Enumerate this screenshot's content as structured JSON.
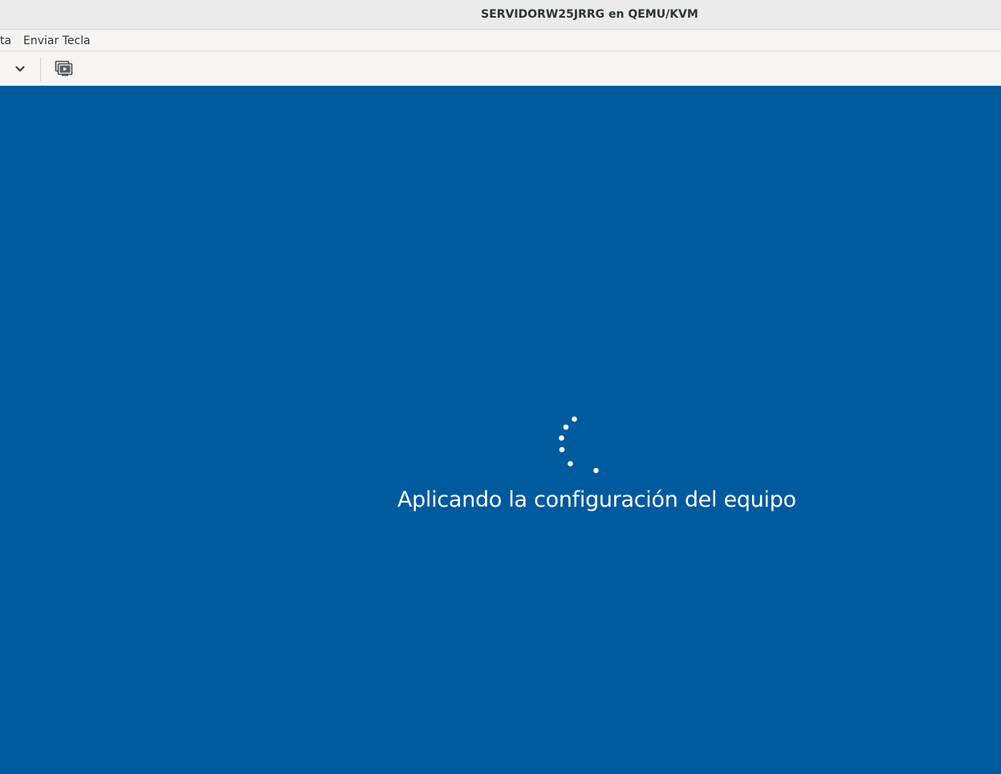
{
  "window": {
    "title": "SERVIDORW25JRRG en QEMU/KVM"
  },
  "menubar": {
    "items": [
      {
        "label": "ta"
      },
      {
        "label": "Enviar Tecla"
      }
    ]
  },
  "toolbar": {
    "dropdown_icon": "chevron-down-icon",
    "console_icon": "console-screens-icon"
  },
  "guest": {
    "background_color": "#005a9e",
    "status_message": "Aplicando la configuración del equipo",
    "spinner_icon": "loading-dots-spinner"
  }
}
